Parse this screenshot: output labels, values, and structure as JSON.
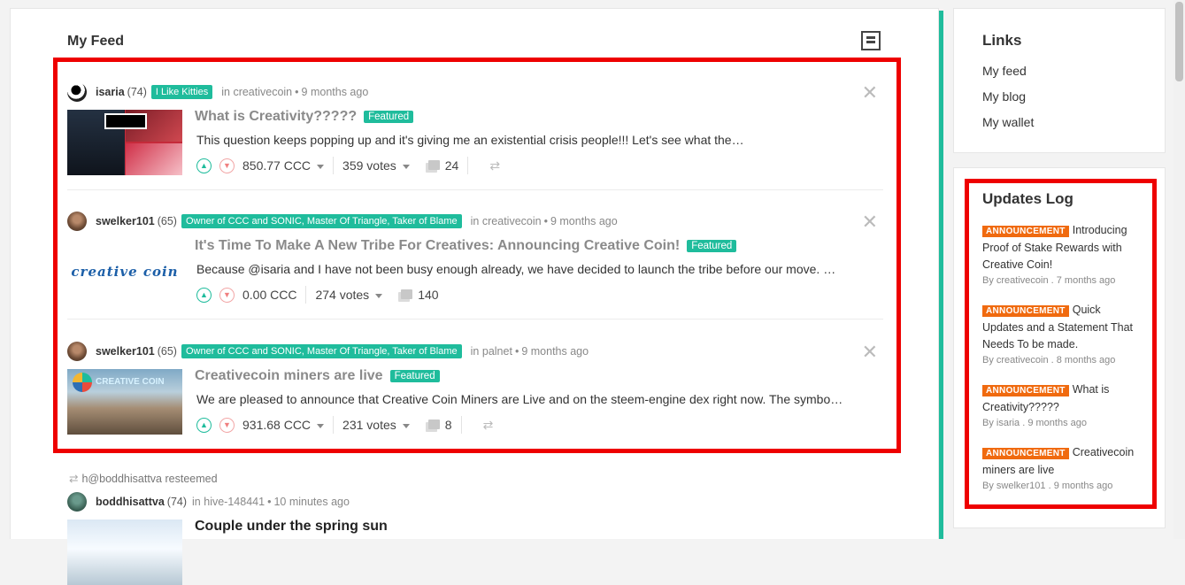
{
  "feed": {
    "title": "My Feed",
    "posts": [
      {
        "author": "isaria",
        "rep": "(74)",
        "badge": "I Like Kitties",
        "in_label": "in",
        "community": "creativecoin",
        "time": "9 months ago",
        "title": "What is Creativity?????",
        "featured": "Featured",
        "excerpt": "This question keeps popping up and it's giving me an existential crisis people!!! Let's see what the…",
        "payout": "850.77 CCC",
        "votes": "359 votes",
        "comments": "24"
      },
      {
        "author": "swelker101",
        "rep": "(65)",
        "badge": "Owner of CCC and SONIC, Master Of Triangle, Taker of Blame",
        "in_label": "in",
        "community": "creativecoin",
        "time": "9 months ago",
        "title": "It's Time To Make A New Tribe For Creatives: Announcing Creative Coin!",
        "featured": "Featured",
        "excerpt": "Because @isaria and I have not been busy enough already, we have decided to launch the tribe before our move. …",
        "payout": "0.00 CCC",
        "votes": "274 votes",
        "comments": "140",
        "thumb_text": "creative coin"
      },
      {
        "author": "swelker101",
        "rep": "(65)",
        "badge": "Owner of CCC and SONIC, Master Of Triangle, Taker of Blame",
        "in_label": "in",
        "community": "palnet",
        "time": "9 months ago",
        "title": "Creativecoin miners are live",
        "featured": "Featured",
        "excerpt": "We are pleased to announce that Creative Coin Miners are Live and on the steem-engine dex right now. The symbo…",
        "payout": "931.68 CCC",
        "votes": "231 votes",
        "comments": "8",
        "thumb_text": "CREATIVE COIN"
      }
    ],
    "resteem": {
      "text": "h@boddhisattva resteemed",
      "author": "boddhisattva",
      "rep": "(74)",
      "in_label": "in",
      "community": "hive-148441",
      "time": "10 minutes ago",
      "title": "Couple under the spring sun"
    }
  },
  "sidebar": {
    "links_title": "Links",
    "links": [
      "My feed",
      "My blog",
      "My wallet"
    ],
    "updates_title": "Updates Log",
    "updates": [
      {
        "badge": "ANNOUNCEMENT",
        "title": "Introducing Proof of Stake Rewards with Creative Coin!",
        "meta": "By creativecoin . 7 months ago"
      },
      {
        "badge": "ANNOUNCEMENT",
        "title": "Quick Updates and a Statement That Needs To be made.",
        "meta": "By creativecoin . 8 months ago"
      },
      {
        "badge": "ANNOUNCEMENT",
        "title": "What is Creativity?????",
        "meta": "By isaria . 9 months ago"
      },
      {
        "badge": "ANNOUNCEMENT",
        "title": "Creativecoin miners are live",
        "meta": "By swelker101 . 9 months ago"
      }
    ]
  },
  "colors": {
    "accent": "#1fbc9c",
    "highlight": "#ee0000",
    "announcement": "#f06a0f"
  }
}
